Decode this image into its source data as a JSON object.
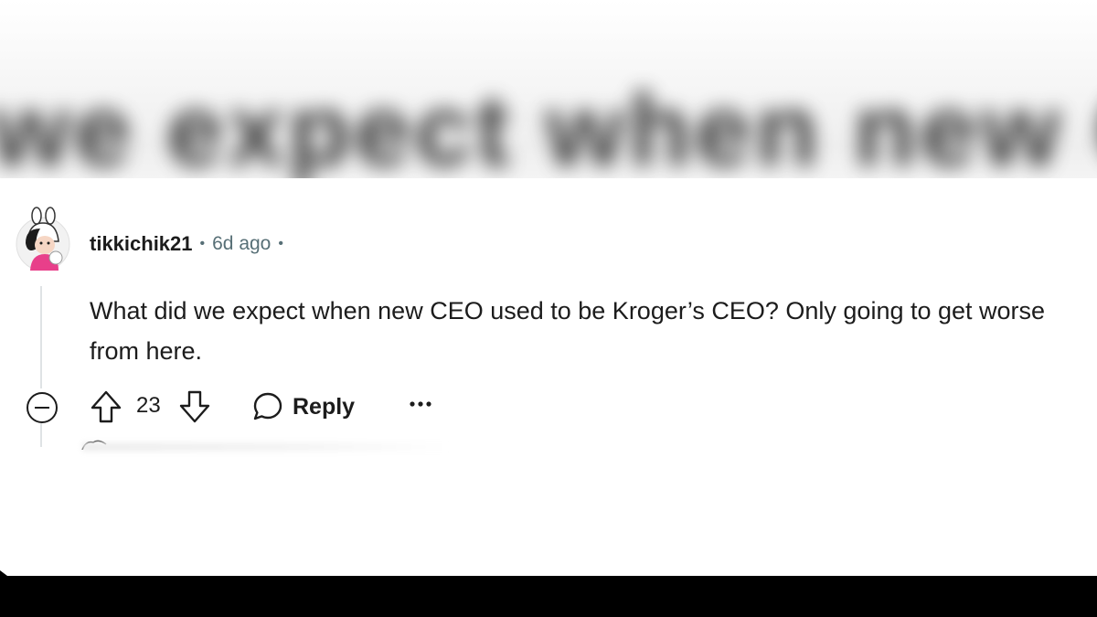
{
  "header": {
    "blurred_text": "we expect when new CEO used"
  },
  "comment": {
    "username": "tikkichik21",
    "separator": "•",
    "time_ago": "6d ago",
    "body": "What did we expect when new CEO used to be Kroger’s CEO? Only going to get worse from here.",
    "score": "23",
    "reply_label": "Reply",
    "icons": {
      "collapse": "collapse-minus-icon",
      "upvote": "upvote-arrow-icon",
      "downvote": "downvote-arrow-icon",
      "reply": "speech-bubble-icon",
      "more": "ellipsis-icon"
    }
  },
  "colors": {
    "text": "#1c1c1c",
    "meta": "#576f76",
    "thread_line": "#dfe3e5",
    "bottom_bar": "#000000"
  }
}
